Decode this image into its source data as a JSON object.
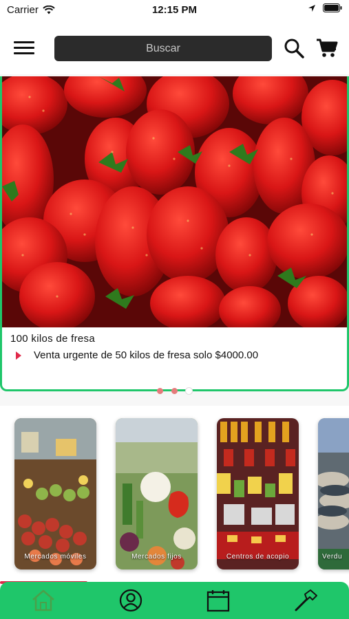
{
  "status_bar": {
    "carrier": "Carrier",
    "time": "12:15 PM"
  },
  "header": {
    "search": {
      "placeholder": "Buscar"
    }
  },
  "banner": {
    "title": "100 kilos de fresa",
    "description": "Venta urgente de 50 kilos de fresa solo $4000.00",
    "pagination": {
      "count": 3,
      "active_index": 2
    }
  },
  "categories": [
    {
      "label": "Mercados móviles"
    },
    {
      "label": "Mercados fijos"
    },
    {
      "label": "Centros de acopio"
    },
    {
      "label": "Verdu"
    }
  ],
  "tabbar": {
    "items": [
      {
        "icon": "home-icon",
        "active": true
      },
      {
        "icon": "user-icon",
        "active": false
      },
      {
        "icon": "calendar-icon",
        "active": false
      },
      {
        "icon": "hammer-icon",
        "active": false
      }
    ],
    "progress_fraction": 0.25
  },
  "colors": {
    "accent": "#1fc66a",
    "bullet": "#e0294a",
    "search_bg": "#2b2b2b"
  }
}
